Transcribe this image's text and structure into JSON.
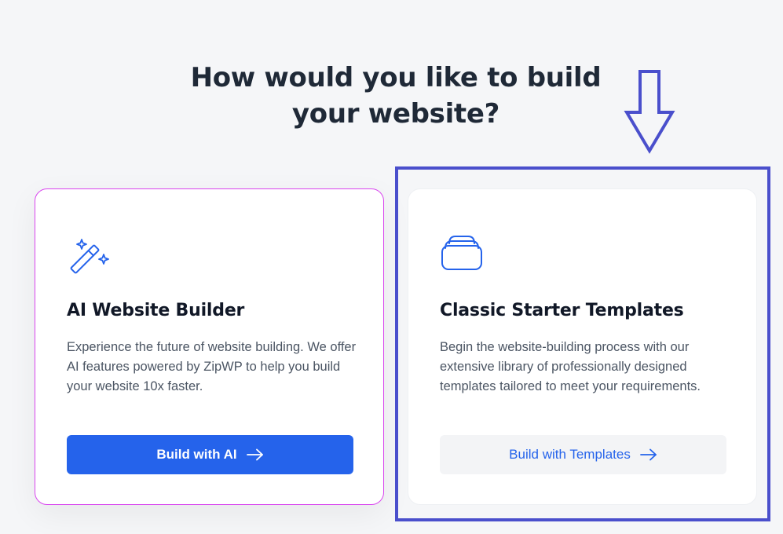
{
  "heading": {
    "line1": "How would you like to build",
    "line2": "your website?"
  },
  "cards": [
    {
      "icon": "magic-wand-icon",
      "title": "AI Website Builder",
      "description": "Experience the future of website building. We offer AI features powered by ZipWP to help you build your website 10x faster.",
      "button_label": "Build with AI",
      "button_icon": "arrow-right-icon"
    },
    {
      "icon": "stacked-templates-icon",
      "title": "Classic Starter Templates",
      "description": "Begin the website-building process with our extensive library of professionally designed templates tailored to meet your requirements.",
      "button_label": "Build with Templates",
      "button_icon": "arrow-right-icon"
    }
  ],
  "annotation": {
    "icon": "down-arrow-icon",
    "highlight": "classic-starter-templates-card"
  },
  "colors": {
    "background": "#f5f6f8",
    "primary": "#2563eb",
    "ai_card_border": "#d946ef",
    "annotation": "#4a4fcc",
    "heading": "#1f2937",
    "body_text": "#4b5563",
    "secondary_button_bg": "#f3f4f6"
  }
}
